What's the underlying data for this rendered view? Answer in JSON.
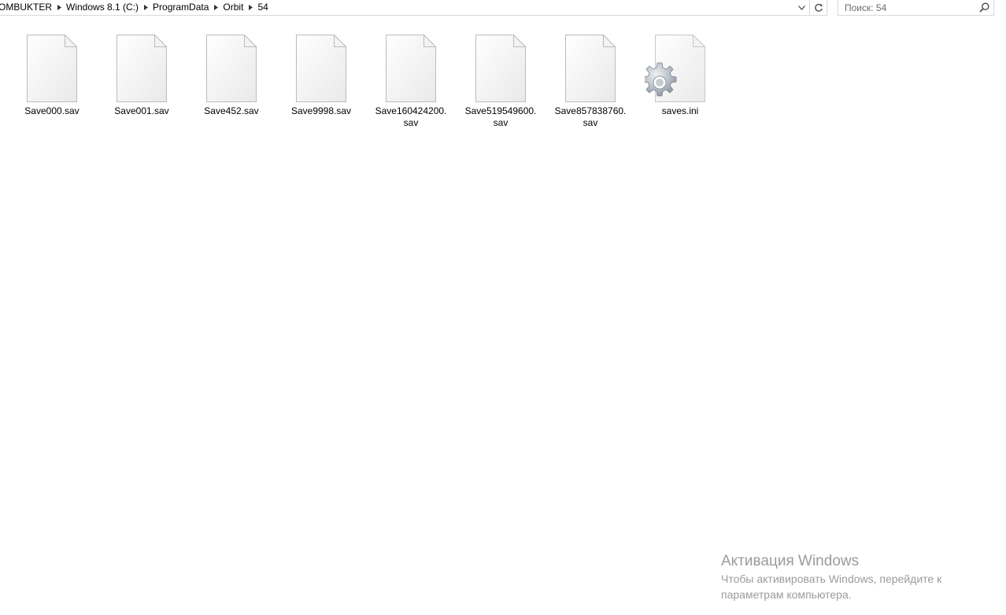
{
  "breadcrumb": {
    "items": [
      {
        "label": "ОМВUKTER"
      },
      {
        "label": "Windows 8.1 (C:)"
      },
      {
        "label": "ProgramData"
      },
      {
        "label": "Orbit"
      },
      {
        "label": "54"
      }
    ]
  },
  "search": {
    "placeholder": "Поиск: 54"
  },
  "files": [
    {
      "name": "Save000.sav",
      "icon": "blank-document-icon"
    },
    {
      "name": "Save001.sav",
      "icon": "blank-document-icon"
    },
    {
      "name": "Save452.sav",
      "icon": "blank-document-icon"
    },
    {
      "name": "Save9998.sav",
      "icon": "blank-document-icon"
    },
    {
      "name": "Save160424200.sav",
      "icon": "blank-document-icon"
    },
    {
      "name": "Save519549600.sav",
      "icon": "blank-document-icon"
    },
    {
      "name": "Save857838760.sav",
      "icon": "blank-document-icon"
    },
    {
      "name": "saves.ini",
      "icon": "settings-document-icon"
    }
  ],
  "activation": {
    "title": "Активация Windows",
    "text": "Чтобы активировать Windows, перейдите к параметрам компьютера."
  },
  "colors": {
    "border": "#d9d9d9",
    "watermark": "#9b9b9b",
    "placeholder": "#6d6d6d"
  }
}
